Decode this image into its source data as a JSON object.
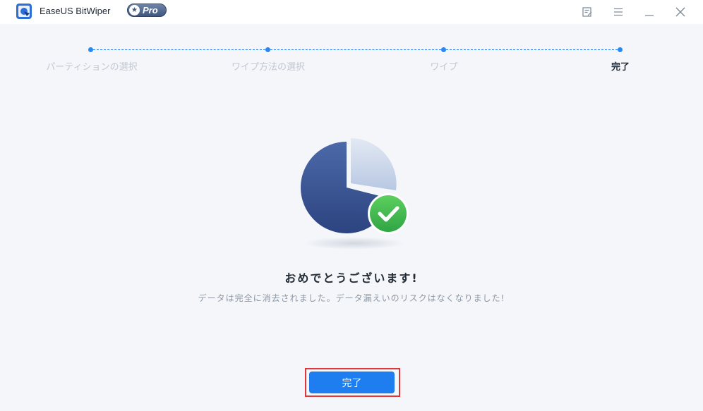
{
  "app": {
    "title": "EaseUS BitWiper",
    "badge": "Pro"
  },
  "window_controls": {
    "feedback": "feedback-icon",
    "menu": "menu-icon",
    "minimize": "minimize-icon",
    "close": "close-icon"
  },
  "steps": [
    {
      "label": "パーティションの選択",
      "state": "done"
    },
    {
      "label": "ワイプ方法の選択",
      "state": "done"
    },
    {
      "label": "ワイプ",
      "state": "done"
    },
    {
      "label": "完了",
      "state": "active"
    }
  ],
  "result": {
    "title": "おめでとうございます!",
    "message": "データは完全に消去されました。データ漏えいのリスクはなくなりました!"
  },
  "actions": {
    "finish_label": "完了"
  },
  "colors": {
    "accent": "#1e7ef0",
    "pie_dark": "#36508f",
    "pie_light": "#c9d6ea",
    "check_green": "#3fb84e",
    "highlight": "#e0373a"
  }
}
